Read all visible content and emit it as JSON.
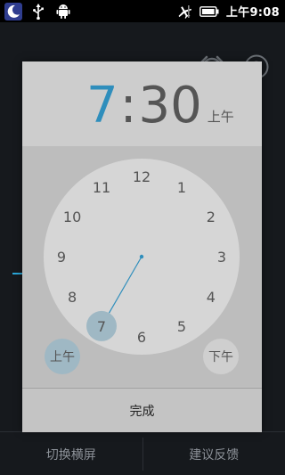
{
  "status_bar": {
    "time": "上午9:08",
    "left_icons": [
      "moon-icon",
      "usb-icon",
      "android-icon"
    ],
    "right_icons": [
      "airplane-mode-icon",
      "battery-icon"
    ]
  },
  "app": {
    "top_icons": [
      "alarm-clock-icon",
      "help-icon"
    ],
    "help_symbol": "?",
    "bottom_buttons": [
      "切换横屏",
      "建议反馈"
    ]
  },
  "time_picker": {
    "hour": "7",
    "separator": ":",
    "minute": "30",
    "ampm": "上午",
    "clock_numbers": [
      "12",
      "1",
      "2",
      "3",
      "4",
      "5",
      "6",
      "7",
      "8",
      "9",
      "10",
      "11"
    ],
    "selected_number": "7",
    "am_label": "上午",
    "pm_label": "下午",
    "selected_period": "上午",
    "done_label": "完成",
    "colors": {
      "accent": "#2f8ebc",
      "selection": "#9fb8c4"
    }
  }
}
